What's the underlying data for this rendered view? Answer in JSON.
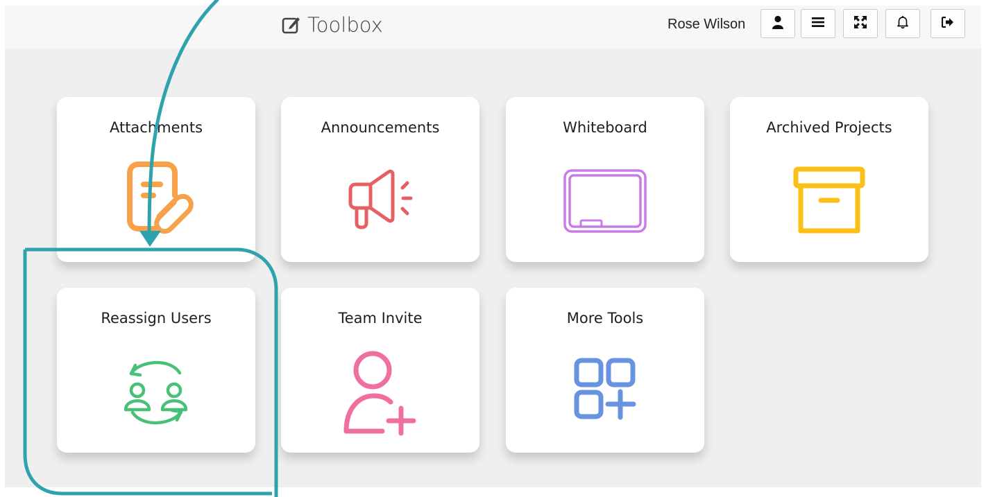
{
  "app": {
    "title": "Toolbox"
  },
  "header": {
    "user_name": "Rose Wilson",
    "buttons": [
      {
        "name": "profile",
        "icon": "user-icon"
      },
      {
        "name": "menu",
        "icon": "bars-icon"
      },
      {
        "name": "fullscreen",
        "icon": "expand-icon"
      },
      {
        "name": "notifications",
        "icon": "bell-icon"
      },
      {
        "name": "logout",
        "icon": "sign-out-icon"
      }
    ]
  },
  "tools": [
    {
      "label": "Attachments",
      "icon": "attachment-document-icon",
      "color": "#f7a14a"
    },
    {
      "label": "Announcements",
      "icon": "megaphone-icon",
      "color": "#e56063"
    },
    {
      "label": "Whiteboard",
      "icon": "whiteboard-icon",
      "color": "#c97be8"
    },
    {
      "label": "Archived Projects",
      "icon": "archive-box-icon",
      "color": "#fbbf16"
    },
    {
      "label": "Reassign Users",
      "icon": "reassign-users-icon",
      "color": "#47c078"
    },
    {
      "label": "Team Invite",
      "icon": "add-user-icon",
      "color": "#ef6fa0"
    },
    {
      "label": "More Tools",
      "icon": "more-tools-grid-icon",
      "color": "#6893e0"
    }
  ],
  "annotation": {
    "color": "#2ea3ae",
    "highlighted_tool": "Reassign Users"
  }
}
